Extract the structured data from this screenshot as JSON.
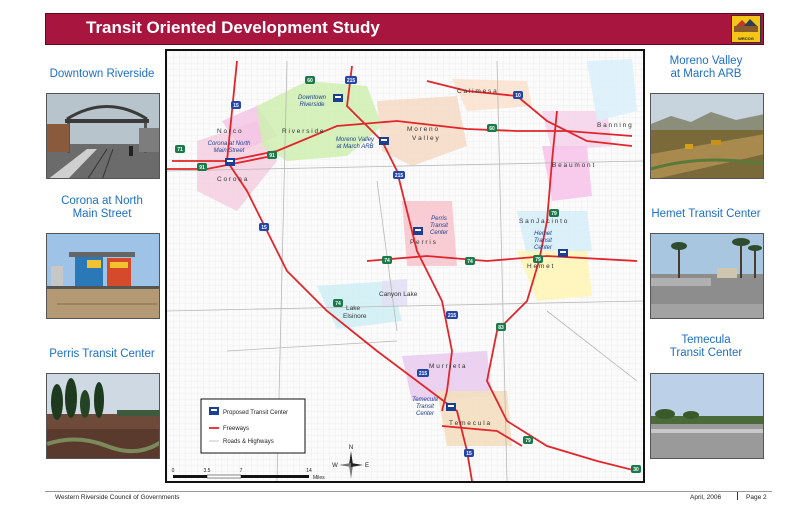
{
  "header": {
    "title": "Transit Oriented Development Study",
    "logo_text": "WRCOG"
  },
  "left_panels": [
    {
      "label_line1": "Downtown Riverside",
      "label_line2": ""
    },
    {
      "label_line1": "Corona at North",
      "label_line2": "Main Street"
    },
    {
      "label_line1": "Perris Transit Center",
      "label_line2": ""
    }
  ],
  "right_panels": [
    {
      "label_line1": "Moreno Valley",
      "label_line2": "at March ARB"
    },
    {
      "label_line1": "Hemet Transit Center",
      "label_line2": ""
    },
    {
      "label_line1": "Temecula",
      "label_line2": "Transit Center"
    }
  ],
  "map": {
    "cities": {
      "norco": "N o r c o",
      "corona": "C o r o n a",
      "riverside": "R i v e r s i d e",
      "moreno_valley_1": "M o r e n o",
      "moreno_valley_2": "V a l l e y",
      "calimesa": "C a l i m e s a",
      "banning": "B a n n i n g",
      "beaumont": "B e a u m o n t",
      "san_jacinto": "S a n  J a c i n t o",
      "hemet": "H e m e t",
      "perris": "P e r r i s",
      "canyon_lake": "Canyon Lake",
      "lake_elsinore_1": "Lake",
      "lake_elsinore_2": "Elsinore",
      "murrieta": "M u r r i e t a",
      "temecula": "T e m e c u l a"
    },
    "transit_centers": {
      "downtown_riverside": [
        "Downtown",
        "Riverside"
      ],
      "corona_north_main": [
        "Corona at North",
        "Main Street"
      ],
      "moreno_valley_march": [
        "Moreno Valley",
        "at March ARB"
      ],
      "perris": [
        "Perris",
        "Transit",
        "Center"
      ],
      "hemet": [
        "Hemet",
        "Transit",
        "Center"
      ],
      "temecula": [
        "Temecula",
        "Transit",
        "Center"
      ]
    },
    "shields": {
      "i15_a": "15",
      "i15_b": "15",
      "i15_c": "15",
      "i215_a": "215",
      "i215_b": "215",
      "i215_c": "215",
      "i10": "10",
      "i215_top": "215",
      "sr60_a": "60",
      "sr60_b": "60",
      "sr91_a": "91",
      "sr91_b": "91",
      "sr71": "71",
      "sr74_a": "74",
      "sr74_b": "74",
      "sr74_c": "74",
      "sr79_a": "79",
      "sr79_b": "79",
      "sr79_c": "79",
      "sr83": "83",
      "sr30": "30"
    },
    "legend": {
      "transit_center": "Proposed Transit Center",
      "freeways": "Freeways",
      "roads": "Roads & Highways"
    },
    "scale": {
      "t0": "0",
      "t1": "3.5",
      "t2": "7",
      "t3": "14",
      "unit": "Miles"
    },
    "compass": {
      "n": "N",
      "s": "S",
      "e": "E",
      "w": "W"
    },
    "colors": {
      "freeway": "#e0262b",
      "transit_icon": "#1c3f94",
      "shield": "#1a7a4a",
      "interstate": "#2446a8"
    }
  },
  "footer": {
    "org": "Western Riverside Council of Governments",
    "date": "April, 2006",
    "page": "Page 2"
  }
}
